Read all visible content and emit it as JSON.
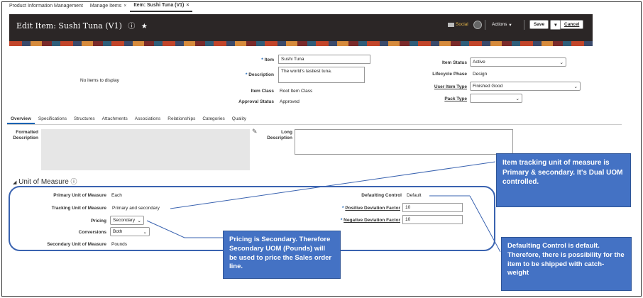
{
  "tabs": [
    {
      "label": "Product Information Management"
    },
    {
      "label": "Manage Items",
      "close": "×"
    },
    {
      "label": "Item: Sushi Tuna (V1)",
      "close": "×"
    }
  ],
  "header": {
    "title": "Edit Item: Sushi Tuna (V1)",
    "social_label": "Social",
    "actions_label": "Actions",
    "save_label": "Save",
    "cancel_label": "Cancel"
  },
  "no_items_text": "No items to display",
  "item": {
    "item_label": "Item",
    "item_value": "Sushi Tuna",
    "description_label": "Description",
    "description_value": "The world's tastiest tuna.",
    "item_class_label": "Item Class",
    "item_class_value": "Root Item Class",
    "approval_status_label": "Approval Status",
    "approval_status_value": "Approved",
    "item_status_label": "Item Status",
    "item_status_value": "Active",
    "lifecycle_phase_label": "Lifecycle Phase",
    "lifecycle_phase_value": "Design",
    "user_item_type_label": "User Item Type",
    "user_item_type_value": "Finished Good",
    "pack_type_label": "Pack Type",
    "pack_type_value": ""
  },
  "subtabs": [
    "Overview",
    "Specifications",
    "Structures",
    "Attachments",
    "Associations",
    "Relationships",
    "Categories",
    "Quality"
  ],
  "overview": {
    "formatted_description_label": "Formatted Description",
    "long_description_label": "Long Description"
  },
  "uom": {
    "section_title": "Unit of Measure",
    "primary_label": "Primary Unit of Measure",
    "primary_value": "Each",
    "tracking_label": "Tracking Unit of Measure",
    "tracking_value": "Primary and secondary",
    "pricing_label": "Pricing",
    "pricing_value": "Secondary",
    "conversions_label": "Conversions",
    "conversions_value": "Both",
    "secondary_label": "Secondary Unit of Measure",
    "secondary_value": "Pounds",
    "defaulting_control_label": "Defaulting Control",
    "defaulting_control_value": "Default",
    "positive_deviation_label": "Positive Deviation Factor",
    "positive_deviation_value": "10",
    "negative_deviation_label": "Negative Deviation Factor",
    "negative_deviation_value": "10"
  },
  "callouts": {
    "tracking": "Item tracking unit of measure is Primary & secondary. It's Dual UOM controlled.",
    "pricing": "Pricing is Secondary. Therefore Secondary UOM (Pounds) will be used to price the Sales order line.",
    "defaulting": "Defaulting Control is default. Therefore, there is possibility for the item to be shipped with catch-weight"
  },
  "colors": {
    "callout": "#4472c4",
    "header": "#2b2626",
    "link": "#1a63b3"
  }
}
